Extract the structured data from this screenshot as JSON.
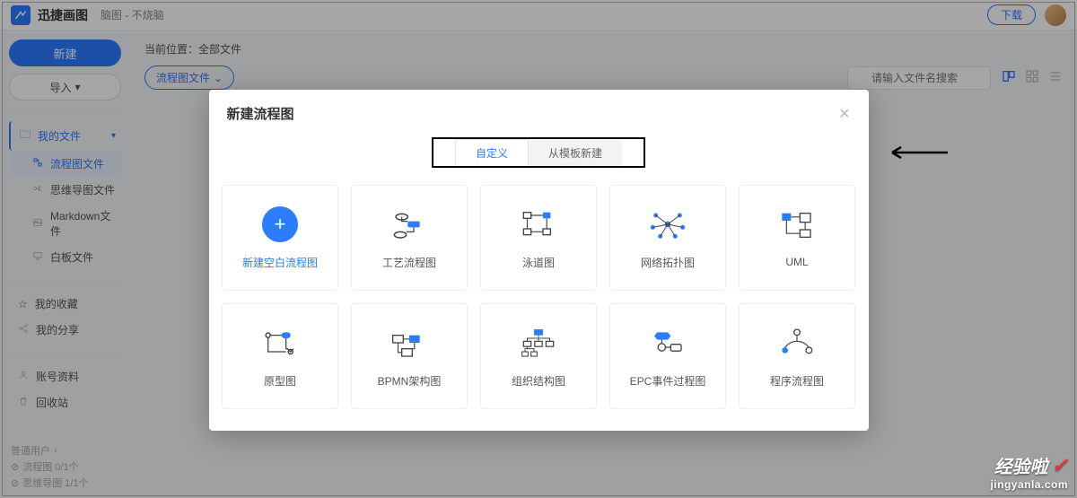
{
  "header": {
    "app_name": "迅捷画图",
    "subtitle": "脑图 - 不烧脑",
    "download": "下载"
  },
  "sidebar": {
    "new_btn": "新建",
    "import_btn": "导入",
    "root": "我的文件",
    "items": [
      {
        "label": "流程图文件"
      },
      {
        "label": "思维导图文件"
      },
      {
        "label": "Markdown文件"
      },
      {
        "label": "白板文件"
      }
    ],
    "extras": [
      {
        "label": "我的收藏"
      },
      {
        "label": "我的分享"
      }
    ],
    "bottom": [
      {
        "label": "账号资料"
      },
      {
        "label": "回收站"
      }
    ],
    "footer": {
      "user": "普通用户",
      "flow_count": "流程图 0/1个",
      "mind_count": "思维导图 1/1个"
    }
  },
  "content": {
    "breadcrumb": "当前位置：全部文件",
    "chip": "流程图文件",
    "search_placeholder": "请输入文件名搜索"
  },
  "modal": {
    "title": "新建流程图",
    "tab_custom": "自定义",
    "tab_template": "从模板新建",
    "cards": [
      {
        "label": "新建空白流程图"
      },
      {
        "label": "工艺流程图"
      },
      {
        "label": "泳道图"
      },
      {
        "label": "网络拓扑图"
      },
      {
        "label": "UML"
      },
      {
        "label": "原型图"
      },
      {
        "label": "BPMN架构图"
      },
      {
        "label": "组织结构图"
      },
      {
        "label": "EPC事件过程图"
      },
      {
        "label": "程序流程图"
      }
    ]
  },
  "watermark": {
    "line1": "经验啦",
    "line2": "jingyanla.com"
  }
}
